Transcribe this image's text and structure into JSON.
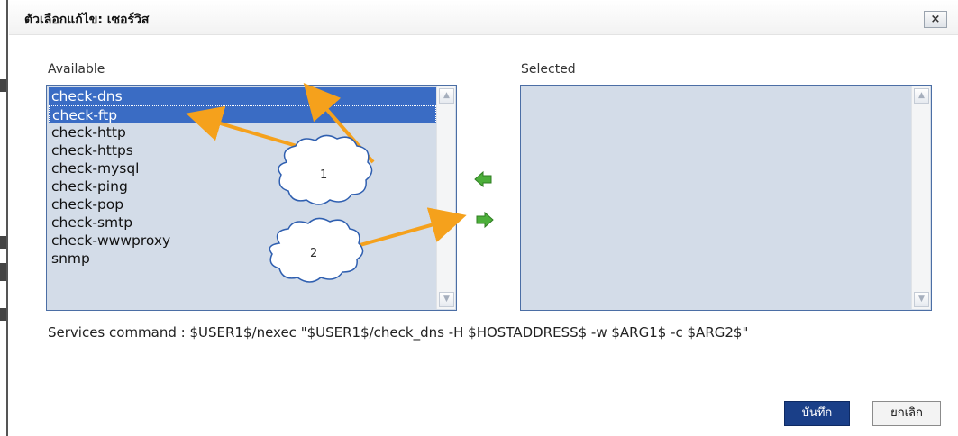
{
  "dialog": {
    "title": "ตัวเลือกแก้ไข: เซอร์วิส",
    "close_label": "×"
  },
  "available": {
    "label": "Available",
    "items": [
      {
        "label": "check-dns",
        "selected": true
      },
      {
        "label": "check-ftp",
        "selected": true
      },
      {
        "label": "check-http",
        "selected": false
      },
      {
        "label": "check-https",
        "selected": false
      },
      {
        "label": "check-mysql",
        "selected": false
      },
      {
        "label": "check-ping",
        "selected": false
      },
      {
        "label": "check-pop",
        "selected": false
      },
      {
        "label": "check-smtp",
        "selected": false
      },
      {
        "label": "check-wwwproxy",
        "selected": false
      },
      {
        "label": "snmp",
        "selected": false
      }
    ]
  },
  "selected": {
    "label": "Selected",
    "items": []
  },
  "move_buttons": {
    "left_icon": "green-arrow-left-icon",
    "right_icon": "green-arrow-right-icon",
    "color": "#4caf3a"
  },
  "command": {
    "text": "Services command : $USER1$/nexec \"$USER1$/check_dns -H $HOSTADDRESS$ -w $ARG1$ -c $ARG2$\""
  },
  "buttons": {
    "save_label": "บันทึก",
    "cancel_label": "ยกเลิก"
  },
  "annotations": {
    "callout_1": "1",
    "callout_2": "2",
    "arrow_color": "#f5a11c"
  }
}
